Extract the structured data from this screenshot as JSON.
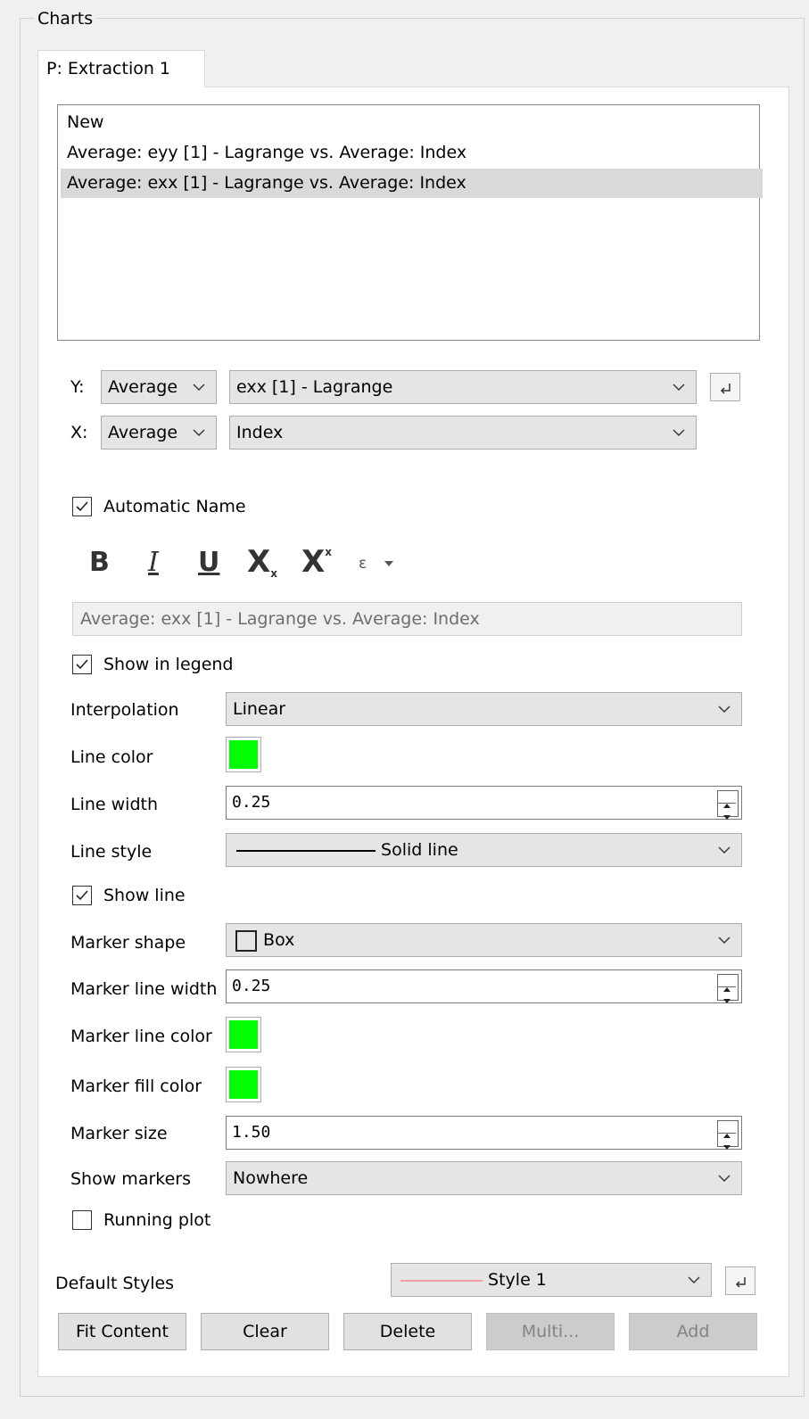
{
  "group": {
    "title": "Charts"
  },
  "tab": {
    "label": "P: Extraction 1"
  },
  "chart_list": {
    "items": [
      "New",
      "Average: eyy [1] - Lagrange vs. Average: Index",
      "Average: exx [1] - Lagrange vs. Average: Index"
    ],
    "selected_index": 2
  },
  "y_axis": {
    "label": "Y:",
    "agg": "Average",
    "variable": "exx [1] - Lagrange"
  },
  "x_axis": {
    "label": "X:",
    "agg": "Average",
    "variable": "Index"
  },
  "automatic_name": {
    "label": "Automatic Name",
    "checked": true
  },
  "format_toolbar": {
    "bold": "B",
    "italic": "I",
    "underline": "U",
    "subscript": "X",
    "subscript_sub": "x",
    "superscript": "X",
    "superscript_sup": "x",
    "symbol": "ε"
  },
  "name_field": {
    "value": "Average: exx [1] - Lagrange vs. Average: Index"
  },
  "show_in_legend": {
    "label": "Show in legend",
    "checked": true
  },
  "interpolation": {
    "label": "Interpolation",
    "value": "Linear"
  },
  "line_color": {
    "label": "Line color",
    "color": "#00ff00"
  },
  "line_width": {
    "label": "Line width",
    "value": "0.25"
  },
  "line_style": {
    "label": "Line style",
    "value": "Solid line"
  },
  "show_line": {
    "label": "Show line",
    "checked": true
  },
  "marker_shape": {
    "label": "Marker shape",
    "value": "Box"
  },
  "marker_line_width": {
    "label": "Marker line width",
    "value": "0.25"
  },
  "marker_line_color": {
    "label": "Marker line color",
    "color": "#00ff00"
  },
  "marker_fill_color": {
    "label": "Marker fill color",
    "color": "#00ff00"
  },
  "marker_size": {
    "label": "Marker size",
    "value": "1.50"
  },
  "show_markers": {
    "label": "Show markers",
    "value": "Nowhere"
  },
  "running_plot": {
    "label": "Running plot",
    "checked": false
  },
  "default_styles": {
    "label": "Default Styles",
    "value": "Style 1",
    "swatch_color": "#f0a0a0"
  },
  "buttons": {
    "fit_content": "Fit Content",
    "clear": "Clear",
    "delete": "Delete",
    "multi": "Multi...",
    "add": "Add"
  }
}
